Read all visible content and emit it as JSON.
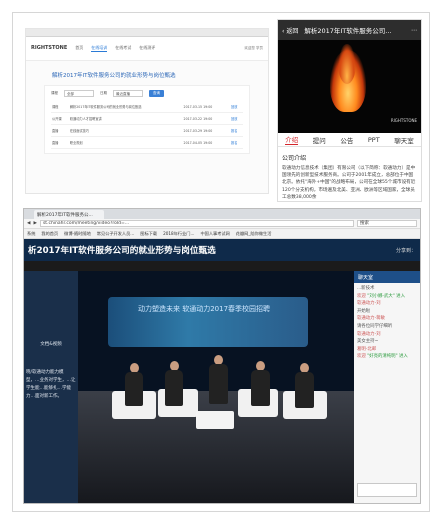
{
  "web_page": {
    "logo": "RIGHTSTONE",
    "nav": [
      "首页",
      "在线培训",
      "在线考试",
      "在线测评"
    ],
    "header_right": "欢迎您 学员",
    "title": "解析2017年IT软件服务公司的就业形势与岗位甄选",
    "form": {
      "label1": "课程",
      "value1": "全部",
      "label2": "日期",
      "value2": "最近直播",
      "button": "查询"
    },
    "rows": [
      {
        "col1": "课程",
        "col2": "解析2017年IT软件服务公司的就业形势与岗位甄选",
        "col3": "2017-03-15 19:00",
        "col4": "回放"
      },
      {
        "col1": "公开课",
        "col2": "软通动力人才招聘宣讲",
        "col3": "2017-03-22 19:00",
        "col4": "回放"
      },
      {
        "col1": "直播",
        "col2": "在线面试技巧",
        "col3": "2017-03-29 19:00",
        "col4": "报名"
      },
      {
        "col1": "直播",
        "col2": "职业规划",
        "col3": "2017-04-05 19:00",
        "col4": "报名"
      }
    ]
  },
  "mobile": {
    "back": "返回",
    "title": "解析2017年IT软件服务公司...",
    "video_logo": "RIGHTSTONE",
    "tabs": [
      "介绍",
      "提问",
      "公告",
      "PPT",
      "聊天室"
    ],
    "intro_heading": "公司介绍",
    "intro_text": "软通动力信息技术（集团）有限公司（以下简称：软通动力）是中国领先的创新型技术服务商。公司于2001年成立，总部位于中国北京。依托\"海外+中国\"的战略布局，公司在全球55个城市设有近120个分支机构，市场遍及北美、亚洲、欧洲等区域国家，全球员工总数38,000余"
  },
  "browser": {
    "tab_title": "解析2017年IT软件服务公...",
    "url": "st.chinahr.com/meeting/video?roId=...",
    "search_placeholder": "搜索",
    "bookmarks": [
      "系统",
      "我的首页",
      "微博-随时随地",
      "常见公子开发人员...",
      "图标下载",
      "2018年行业门...",
      "中国人事考试网",
      "花瓣网_陪你做生活"
    ],
    "banner_title": "析2017年IT软件服务公司的就业形势与岗位甄选",
    "share_label": "分享到：",
    "left_panel_top": "",
    "left_panel_mid": "文档&视频",
    "left_panel_text": "晓/软通动力能力模型，…业务对学生，…让学生能…能够扎…学能力…面对新工作。",
    "stage_banner": "动力塑造未来  软通动力2017春季校园招聘",
    "chat_title": "聊天室",
    "chat_messages": [
      {
        "user": "",
        "text": "...新技术"
      },
      {
        "user": "欢迎",
        "text": "\"刘小娜-武大\" 进入"
      },
      {
        "user": "软通动力-刘",
        "text": "开始啦"
      },
      {
        "user": "软通动力-蒋敏",
        "text": "请各位同学仔细听"
      },
      {
        "user": "软通动力-刘",
        "text": "美女主持~"
      },
      {
        "user": "葛明-北邮",
        "text": ""
      },
      {
        "user": "欢迎",
        "text": "\"好亮的清纯明\" 进入"
      }
    ]
  }
}
